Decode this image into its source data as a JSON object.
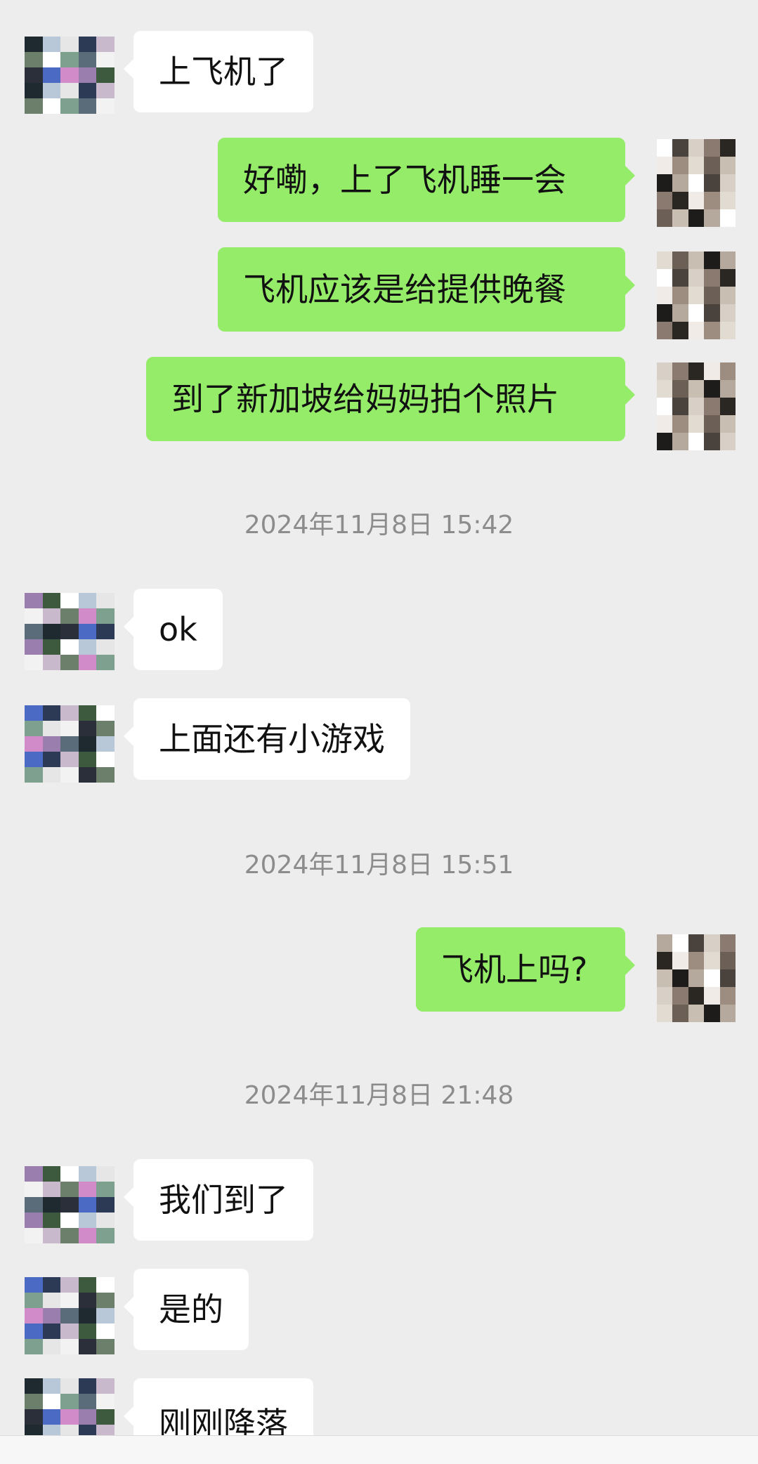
{
  "colors": {
    "background": "#ededed",
    "incoming_bubble": "#ffffff",
    "outgoing_bubble": "#95ec69",
    "timestamp_text": "#8c8c8c"
  },
  "messages": [
    {
      "text": "上飞机了"
    },
    {
      "text": "好嘞，上了飞机睡一会"
    },
    {
      "text": "飞机应该是给提供晚餐"
    },
    {
      "text": "到了新加坡给妈妈拍个照片"
    },
    {
      "text": "ok"
    },
    {
      "text": "上面还有小游戏"
    },
    {
      "text": "飞机上吗?"
    },
    {
      "text": "我们到了"
    },
    {
      "text": "是的"
    },
    {
      "text": "刚刚降落"
    }
  ],
  "timestamps": [
    "2024年11月8日 15:42",
    "2024年11月8日 15:51",
    "2024年11月8日 21:48"
  ]
}
